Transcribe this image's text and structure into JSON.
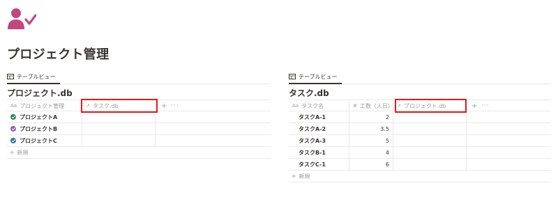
{
  "page": {
    "icon": "user-check-icon",
    "title": "プロジェクト管理",
    "accent_color": "#c3477d"
  },
  "left": {
    "view_tab": "テーブルビュー",
    "db_title": "プロジェクト.db",
    "columns": [
      {
        "icon": "Aa",
        "label": "プロジェクト管理"
      },
      {
        "icon": "↗",
        "label": "タスク.db"
      }
    ],
    "rows": [
      {
        "name": "プロジェクトA",
        "check_color": "#2e7d5b"
      },
      {
        "name": "プロジェクトB",
        "check_color": "#8e5bb8"
      },
      {
        "name": "プロジェクトC",
        "check_color": "#2b76a8"
      }
    ],
    "new_label": "新規"
  },
  "right": {
    "view_tab": "テーブルビュー",
    "db_title": "タスク.db",
    "columns": [
      {
        "icon": "Aa",
        "label": "タスク名"
      },
      {
        "icon": "#",
        "label": "工数（人日）"
      },
      {
        "icon": "↗",
        "label": "プロジェクト.db"
      }
    ],
    "rows": [
      {
        "name": "タスクA-1",
        "effort": "2"
      },
      {
        "name": "タスクA-2",
        "effort": "3.5"
      },
      {
        "name": "タスクA-3",
        "effort": "5"
      },
      {
        "name": "タスクB-1",
        "effort": "4"
      },
      {
        "name": "タスクC-1",
        "effort": "6"
      }
    ],
    "new_label": "新規"
  },
  "toolbar": {
    "add_symbol": "+",
    "more_symbol": "···"
  },
  "highlight_color": "#e5191b"
}
